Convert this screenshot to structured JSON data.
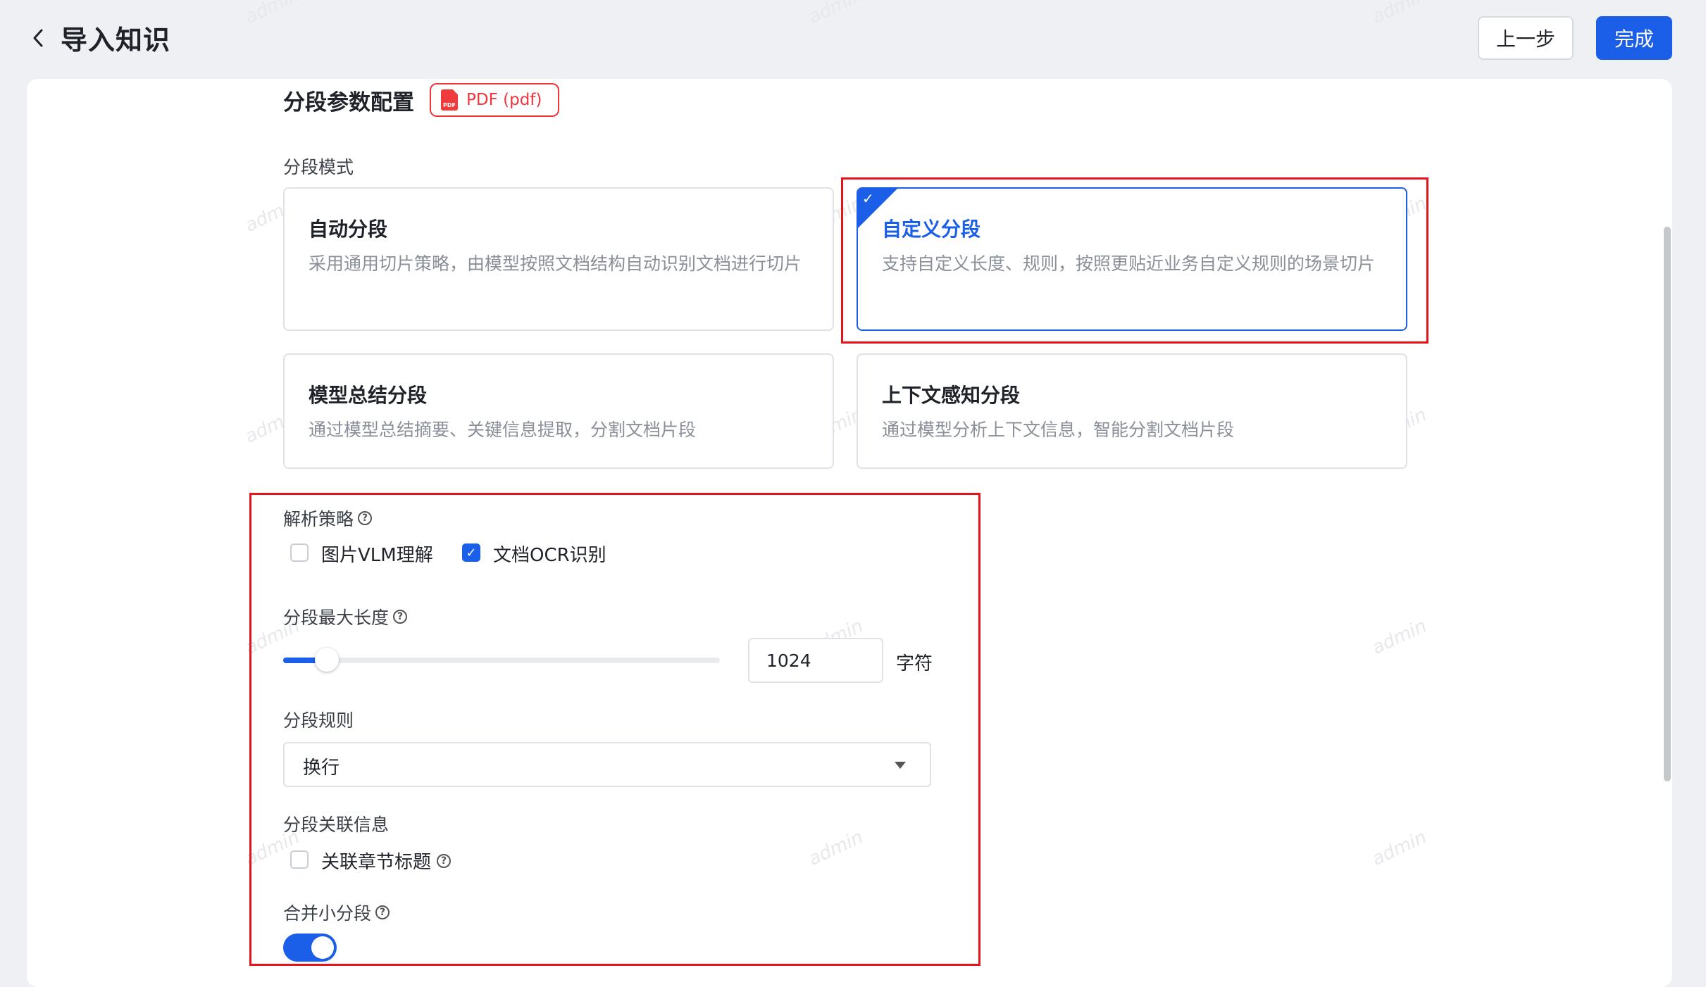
{
  "header": {
    "title": "导入知识",
    "prev_label": "上一步",
    "done_label": "完成"
  },
  "section": {
    "title": "分段参数配置",
    "file_tag": "PDF (pdf)"
  },
  "mode": {
    "label": "分段模式",
    "options": [
      {
        "title": "自动分段",
        "desc": "采用通用切片策略，由模型按照文档结构自动识别文档进行切片",
        "selected": false
      },
      {
        "title": "自定义分段",
        "desc": "支持自定义长度、规则，按照更贴近业务自定义规则的场景切片",
        "selected": true
      },
      {
        "title": "模型总结分段",
        "desc": "通过模型总结摘要、关键信息提取，分割文档片段",
        "selected": false
      },
      {
        "title": "上下文感知分段",
        "desc": "通过模型分析上下文信息，智能分割文档片段",
        "selected": false
      }
    ]
  },
  "parse": {
    "label": "解析策略",
    "options": [
      {
        "label": "图片VLM理解",
        "checked": false
      },
      {
        "label": "文档OCR识别",
        "checked": true
      }
    ]
  },
  "max_length": {
    "label": "分段最大长度",
    "value": "1024",
    "unit": "字符",
    "slider_fraction": 0.1
  },
  "rule": {
    "label": "分段规则",
    "value": "换行"
  },
  "relation": {
    "label": "分段关联信息",
    "option_label": "关联章节标题",
    "checked": false
  },
  "merge": {
    "label": "合并小分段",
    "enabled": true
  },
  "watermark_text": "admin",
  "colors": {
    "accent": "#1b5fe8",
    "highlight": "#e5141b",
    "tag": "#f0363d"
  }
}
